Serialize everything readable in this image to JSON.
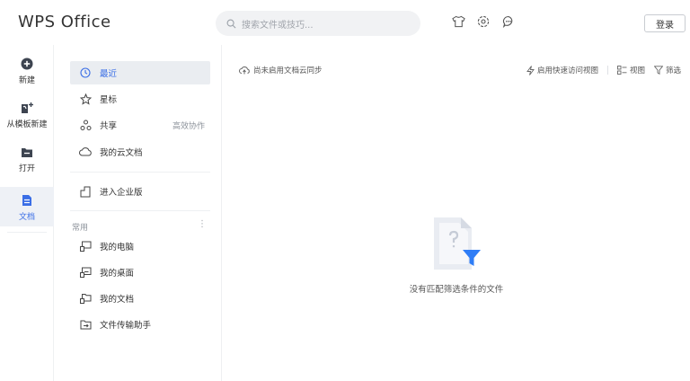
{
  "header": {
    "logo": "WPS Office",
    "search_placeholder": "搜索文件或技巧...",
    "icons": [
      "skin-icon",
      "settings-icon",
      "feedback-icon"
    ],
    "login_label": "登录"
  },
  "rail": {
    "items": [
      {
        "label": "新建",
        "icon": "plus-circle-icon"
      },
      {
        "label": "从模板新建",
        "icon": "template-icon"
      },
      {
        "label": "打开",
        "icon": "folder-icon"
      },
      {
        "label": "文档",
        "icon": "document-icon",
        "active": true
      }
    ]
  },
  "nav": {
    "items": [
      {
        "label": "最近",
        "icon": "clock-icon",
        "active": true
      },
      {
        "label": "星标",
        "icon": "star-icon"
      },
      {
        "label": "共享",
        "icon": "share-icon",
        "side": "高效协作"
      },
      {
        "label": "我的云文档",
        "icon": "cloud-icon"
      },
      {
        "label": "进入企业版",
        "icon": "enterprise-icon"
      }
    ],
    "section_title": "常用",
    "common": [
      {
        "label": "我的电脑",
        "icon": "computer-icon"
      },
      {
        "label": "我的桌面",
        "icon": "desktop-icon"
      },
      {
        "label": "我的文档",
        "icon": "documents-folder-icon"
      },
      {
        "label": "文件传输助手",
        "icon": "transfer-icon"
      }
    ]
  },
  "main": {
    "sync_text": "尚未启用文档云同步",
    "tools": {
      "quick_view": "启用快速访问视图",
      "view": "视图",
      "filter": "筛选"
    },
    "empty_message": "没有匹配筛选条件的文件"
  },
  "colors": {
    "accent": "#3a6ee6",
    "active_bg": "#eaedf1",
    "filter_funnel": "#2f7df6"
  }
}
